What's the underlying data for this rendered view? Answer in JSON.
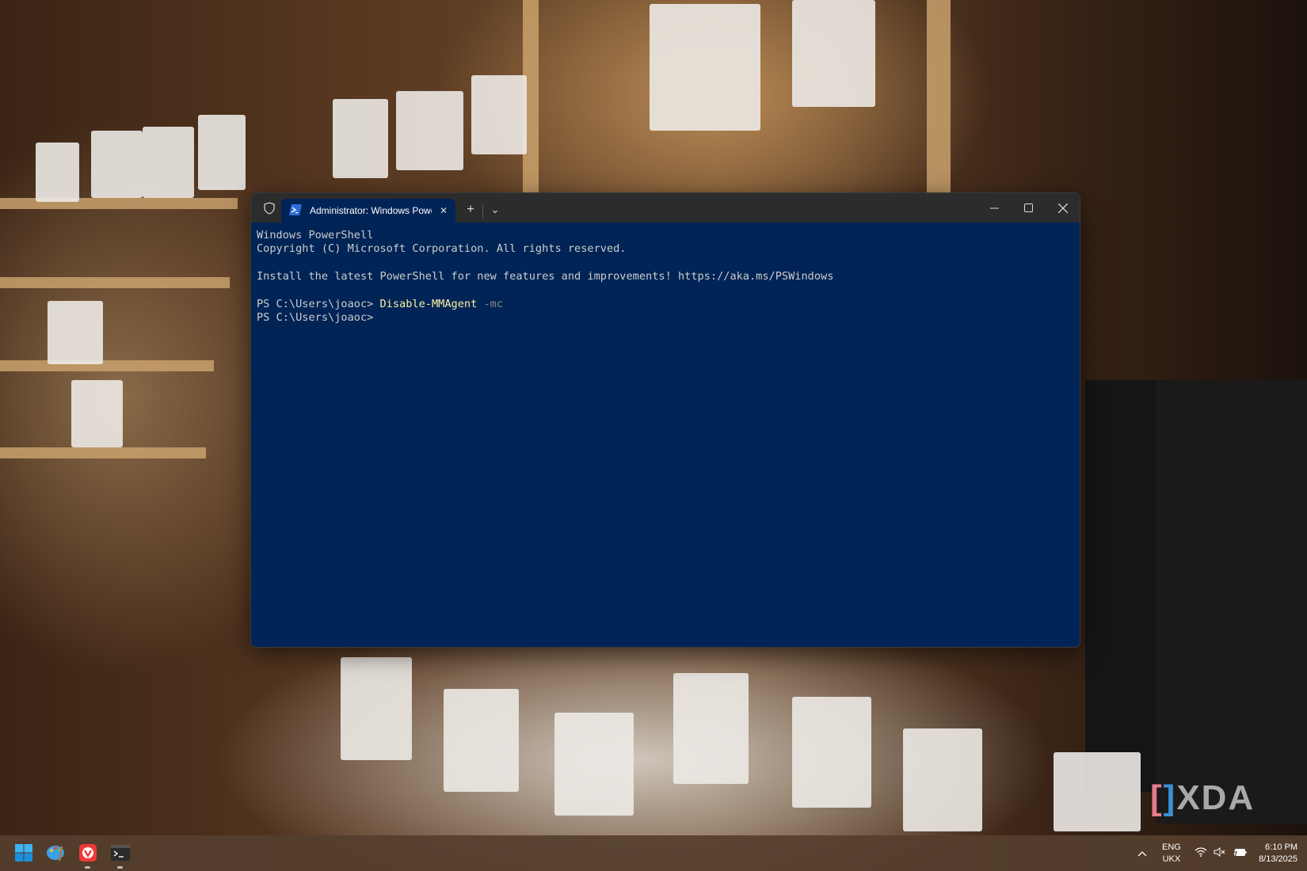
{
  "window": {
    "tab_title": "Administrator: Windows PowerShell",
    "new_tab": "+",
    "dropdown": "⌄",
    "minimize": "—",
    "maximize": "☐",
    "close": "✕"
  },
  "terminal": {
    "line1": "Windows PowerShell",
    "line2": "Copyright (C) Microsoft Corporation. All rights reserved.",
    "line3": "Install the latest PowerShell for new features and improvements! https://aka.ms/PSWindows",
    "prompt1": "PS C:\\Users\\joaoc> ",
    "command": "Disable-MMAgent",
    "param": " -mc",
    "prompt2": "PS C:\\Users\\joaoc>"
  },
  "taskbar": {
    "lang_top": "ENG",
    "lang_bottom": "UKX",
    "time": "6:10 PM",
    "date": "8/13/2025",
    "chevron": "^"
  },
  "watermark": "XDA"
}
